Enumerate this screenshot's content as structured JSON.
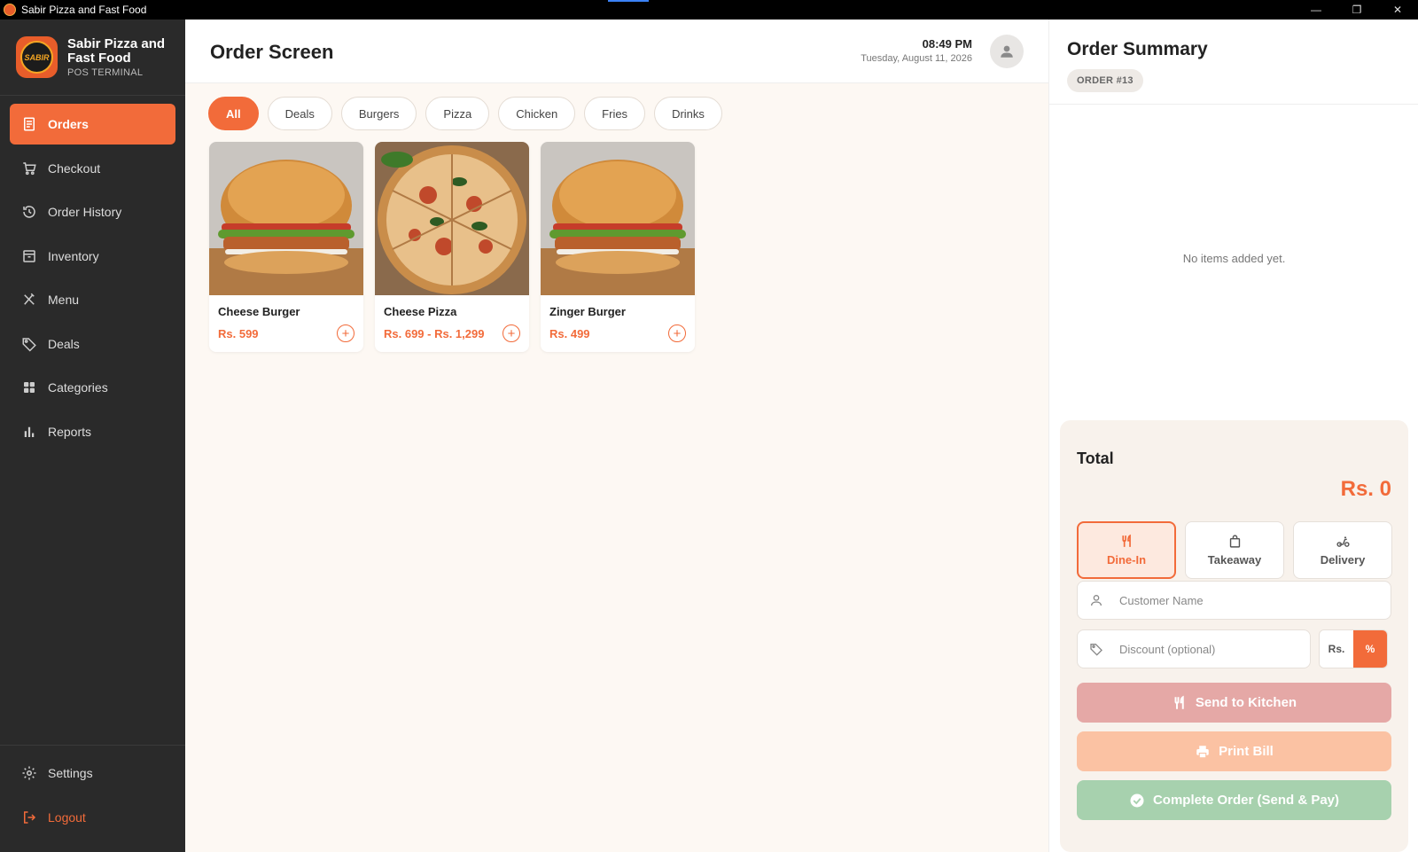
{
  "window": {
    "title": "Sabir Pizza and Fast Food",
    "controls": {
      "minimize": "—",
      "restore": "❐",
      "close": "✕"
    }
  },
  "brand": {
    "name": "Sabir Pizza and Fast Food",
    "subtitle": "POS TERMINAL",
    "logo_text": "SABIR"
  },
  "sidebar": {
    "items": [
      {
        "label": "Orders",
        "icon": "receipt-icon",
        "active": true
      },
      {
        "label": "Checkout",
        "icon": "cart-icon"
      },
      {
        "label": "Order History",
        "icon": "history-icon"
      },
      {
        "label": "Inventory",
        "icon": "archive-icon"
      },
      {
        "label": "Menu",
        "icon": "utensils-icon"
      },
      {
        "label": "Deals",
        "icon": "tag-icon"
      },
      {
        "label": "Categories",
        "icon": "grid-icon"
      },
      {
        "label": "Reports",
        "icon": "bar-chart-icon"
      }
    ],
    "bottom": [
      {
        "label": "Settings",
        "icon": "gear-icon"
      },
      {
        "label": "Logout",
        "icon": "logout-icon"
      }
    ]
  },
  "header": {
    "title": "Order Screen",
    "time": "08:49 PM",
    "date": "Tuesday, August 11, 2026"
  },
  "filters": [
    "All",
    "Deals",
    "Burgers",
    "Pizza",
    "Chicken",
    "Fries",
    "Drinks"
  ],
  "active_filter": "All",
  "products": [
    {
      "name": "Cheese Burger",
      "price": "Rs. 599",
      "image": "burger"
    },
    {
      "name": "Cheese Pizza",
      "price": "Rs. 699 - Rs. 1,299",
      "image": "pizza"
    },
    {
      "name": "Zinger Burger",
      "price": "Rs. 499",
      "image": "burger"
    }
  ],
  "summary": {
    "title": "Order Summary",
    "order_badge": "ORDER #13",
    "empty_text": "No items added yet.",
    "total_label": "Total",
    "total_value": "Rs. 0",
    "order_types": [
      {
        "label": "Dine-In",
        "icon": "utensils-icon",
        "active": true
      },
      {
        "label": "Takeaway",
        "icon": "bag-icon"
      },
      {
        "label": "Delivery",
        "icon": "scooter-icon"
      }
    ],
    "customer_placeholder": "Customer Name",
    "discount_placeholder": "Discount (optional)",
    "discount_modes": {
      "rs": "Rs.",
      "percent": "%",
      "selected": "%"
    },
    "actions": {
      "send_kitchen": "Send to Kitchen",
      "print_bill": "Print Bill",
      "complete": "Complete Order (Send & Pay)"
    }
  },
  "colors": {
    "accent": "#f26b3a",
    "sidebar": "#2a2a2a",
    "kitchen": "#e5a8a6",
    "print": "#fbc2a3",
    "complete": "#a7d1ae"
  }
}
